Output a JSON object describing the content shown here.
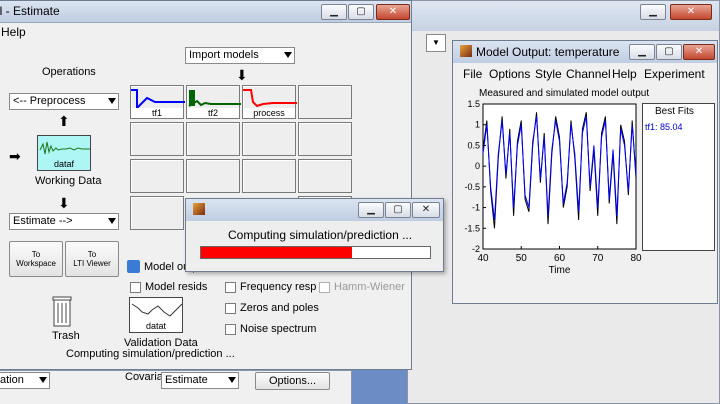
{
  "ident": {
    "title": "ol - Estimate",
    "menu": [
      "Help"
    ],
    "import_models": "Import models",
    "operations_label": "Operations",
    "preprocess": "<-- Preprocess",
    "working_data_name": "dataf",
    "working_data_label": "Working Data",
    "estimate": "Estimate -->",
    "to_workspace": [
      "To",
      "Workspace"
    ],
    "to_lti_viewer": [
      "To",
      "LTI Viewer"
    ],
    "trash_label": "Trash",
    "validation_data_name": "datat",
    "validation_data_label": "Validation Data",
    "status": "Computing simulation/prediction ...",
    "models": [
      {
        "name": "tf1",
        "color": "#0000ff"
      },
      {
        "name": "tf2",
        "color": "#006400"
      },
      {
        "name": "process",
        "color": "#ff0000"
      }
    ],
    "checks": {
      "model_output": "Model outp",
      "model_resids": "Model resids",
      "frequency_resp": "Frequency resp",
      "zeros_poles": "Zeros and poles",
      "noise_spectrum": "Noise spectrum",
      "hammerstein": "Hamm-Wiener"
    }
  },
  "bottom": {
    "left_popup": "ation",
    "covariance_label": "Covariance:",
    "covariance_value": "Estimate",
    "options_button": "Options..."
  },
  "model_output": {
    "title": "Model Output: temperature",
    "menu": [
      "File",
      "Options",
      "Style",
      "Channel",
      "Help",
      "Experiment"
    ],
    "plot_title": "Measured and simulated model output",
    "best_fits_title": "Best Fits",
    "best_fit_entry": "tf1: 85.04",
    "best_fit_color": "#0000cc"
  },
  "progress": {
    "message": "Computing simulation/prediction ...",
    "fraction": 0.66,
    "color": "#ff0000"
  },
  "chart_data": {
    "type": "line",
    "title": "Measured and simulated model output",
    "xlabel": "Time",
    "ylabel": "",
    "xlim": [
      40,
      80
    ],
    "ylim": [
      -2,
      1.5
    ],
    "x_ticks": [
      "40",
      "50",
      "60",
      "70",
      "80"
    ],
    "y_ticks": [
      "1.5",
      "1",
      "0.5",
      "0",
      "-0.5",
      "-1",
      "-1.5",
      "-2"
    ],
    "series": [
      {
        "color": "#000000",
        "x": [
          40,
          41,
          42,
          43,
          44,
          45,
          46,
          47,
          48,
          49,
          50,
          51,
          52,
          53,
          54,
          55,
          56,
          57,
          58,
          59,
          60,
          61,
          62,
          63,
          64,
          65,
          66,
          67,
          68,
          69,
          70,
          71,
          72,
          73,
          74,
          75,
          76,
          77,
          78,
          79,
          80
        ],
        "y": [
          0.4,
          1.1,
          -0.6,
          -1.5,
          0.2,
          1.2,
          -0.3,
          0.9,
          -1.2,
          0.6,
          1.1,
          -0.8,
          -1.1,
          0.5,
          1.3,
          -0.4,
          0.8,
          -1.4,
          0.3,
          1.2,
          0.7,
          -1.0,
          -0.5,
          1.1,
          0.2,
          -1.3,
          0.9,
          1.3,
          -0.6,
          0.4,
          -1.2,
          0.8,
          1.2,
          -0.9,
          0.3,
          -1.4,
          1.0,
          0.6,
          -0.7,
          1.1,
          -0.3
        ]
      },
      {
        "color": "#0000ff",
        "x": [
          40,
          41,
          42,
          43,
          44,
          45,
          46,
          47,
          48,
          49,
          50,
          51,
          52,
          53,
          54,
          55,
          56,
          57,
          58,
          59,
          60,
          61,
          62,
          63,
          64,
          65,
          66,
          67,
          68,
          69,
          70,
          71,
          72,
          73,
          74,
          75,
          76,
          77,
          78,
          79,
          80
        ],
        "y": [
          0.3,
          1.0,
          -0.5,
          -1.3,
          0.3,
          1.1,
          -0.2,
          0.8,
          -1.0,
          0.5,
          1.0,
          -0.7,
          -1.0,
          0.6,
          1.2,
          -0.3,
          0.7,
          -1.2,
          0.4,
          1.1,
          0.6,
          -0.9,
          -0.4,
          1.0,
          0.3,
          -1.1,
          0.8,
          1.2,
          -0.5,
          0.5,
          -1.0,
          0.7,
          1.1,
          -0.8,
          0.4,
          -1.2,
          0.9,
          0.5,
          -0.6,
          1.0,
          -0.2
        ]
      }
    ]
  }
}
